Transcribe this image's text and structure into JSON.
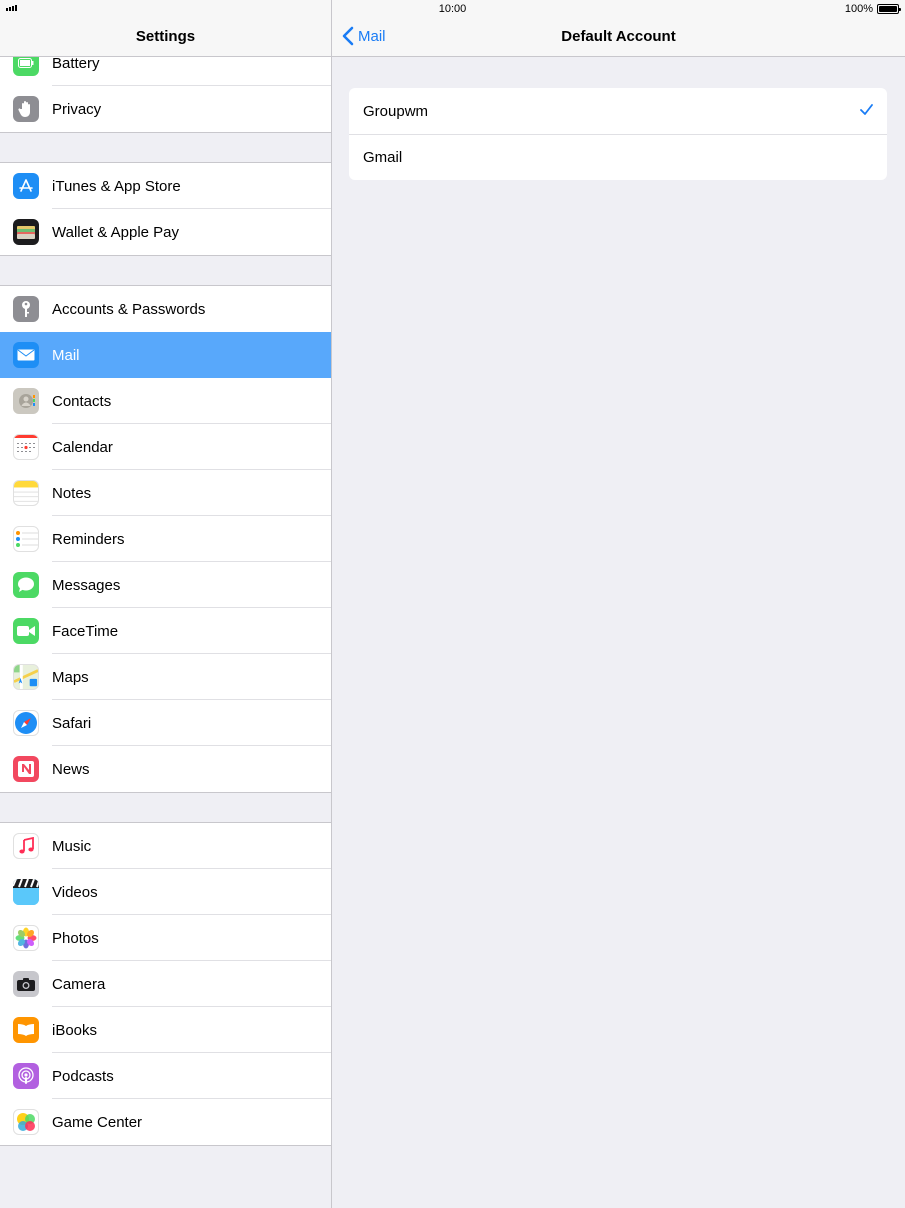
{
  "status_bar": {
    "time": "10:00",
    "battery_percent": "100%",
    "battery_level": 1.0
  },
  "left": {
    "title": "Settings",
    "groups": [
      {
        "items": [
          {
            "label": "Battery",
            "icon": "battery-icon",
            "color": "#4cd964"
          },
          {
            "label": "Privacy",
            "icon": "hand-icon",
            "color": "#8e8e93"
          }
        ]
      },
      {
        "items": [
          {
            "label": "iTunes & App Store",
            "icon": "app-store-icon",
            "color": "#1e8ef5"
          },
          {
            "label": "Wallet & Apple Pay",
            "icon": "wallet-icon",
            "color": "#1c1c1e"
          }
        ]
      },
      {
        "items": [
          {
            "label": "Accounts & Passwords",
            "icon": "key-icon",
            "color": "#8e8e93"
          },
          {
            "label": "Mail",
            "icon": "envelope-icon",
            "color": "#1e8ef5",
            "selected": true
          },
          {
            "label": "Contacts",
            "icon": "contacts-icon",
            "color": "#b9b6ae"
          },
          {
            "label": "Calendar",
            "icon": "calendar-icon",
            "color": "#ffffff"
          },
          {
            "label": "Notes",
            "icon": "notes-icon",
            "color": "#ffd93b"
          },
          {
            "label": "Reminders",
            "icon": "reminders-icon",
            "color": "#ffffff"
          },
          {
            "label": "Messages",
            "icon": "speech-bubble-icon",
            "color": "#4cd964"
          },
          {
            "label": "FaceTime",
            "icon": "video-camera-icon",
            "color": "#4cd964"
          },
          {
            "label": "Maps",
            "icon": "map-icon",
            "color": "#8fd58a"
          },
          {
            "label": "Safari",
            "icon": "compass-icon",
            "color": "#1e8ef5"
          },
          {
            "label": "News",
            "icon": "news-icon",
            "color": "#f2485f"
          }
        ]
      },
      {
        "items": [
          {
            "label": "Music",
            "icon": "music-note-icon",
            "color": "#ffffff"
          },
          {
            "label": "Videos",
            "icon": "clapperboard-icon",
            "color": "#5ac8fa"
          },
          {
            "label": "Photos",
            "icon": "flower-icon",
            "color": "#ffffff"
          },
          {
            "label": "Camera",
            "icon": "camera-icon",
            "color": "#8e8e93"
          },
          {
            "label": "iBooks",
            "icon": "book-icon",
            "color": "#ff9500"
          },
          {
            "label": "Podcasts",
            "icon": "podcast-icon",
            "color": "#b260e0"
          },
          {
            "label": "Game Center",
            "icon": "bubbles-icon",
            "color": "#ffffff"
          }
        ]
      }
    ]
  },
  "right": {
    "back_label": "Mail",
    "title": "Default Account",
    "accounts": [
      {
        "label": "Groupwm",
        "checked": true
      },
      {
        "label": "Gmail",
        "checked": false
      }
    ]
  },
  "colors": {
    "accent": "#1a7cf5",
    "selected_row": "#58a8fb",
    "background": "#efeff4"
  }
}
